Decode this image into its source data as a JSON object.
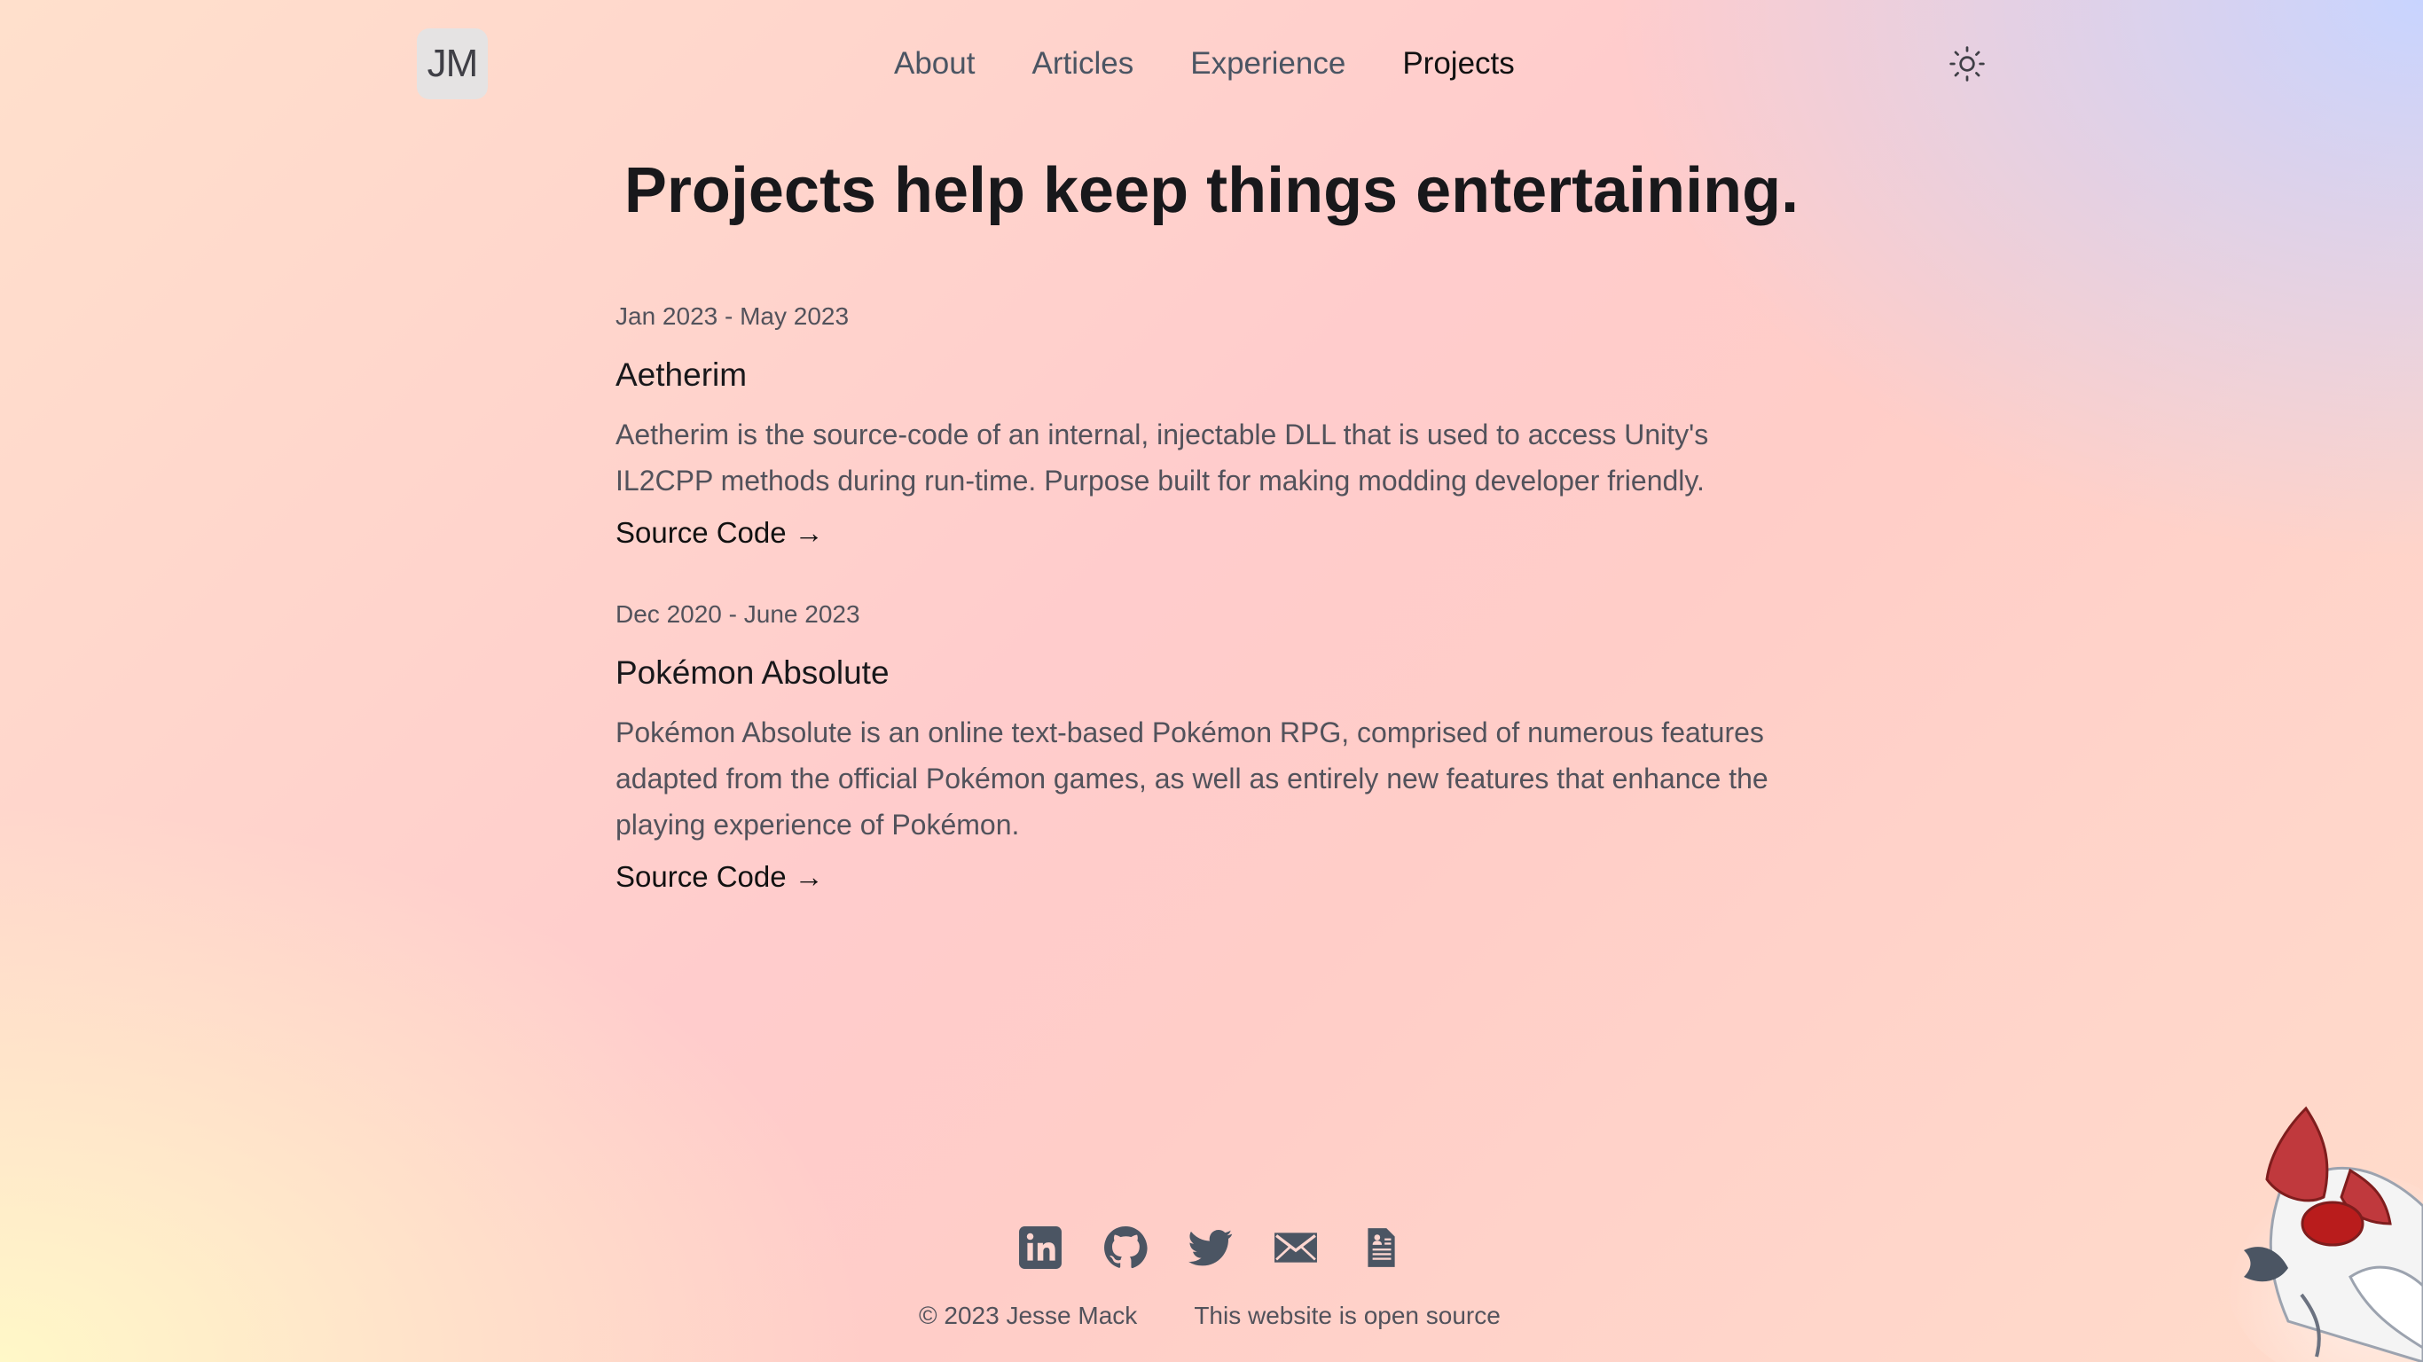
{
  "header": {
    "logo_text": "JM",
    "nav": [
      {
        "label": "About"
      },
      {
        "label": "Articles"
      },
      {
        "label": "Experience"
      },
      {
        "label": "Projects",
        "active": true
      }
    ],
    "theme_toggle_icon": "sun-icon"
  },
  "main": {
    "title": "Projects help keep things entertaining.",
    "projects": [
      {
        "date": "Jan 2023 - May 2023",
        "name": "Aetherim",
        "description": "Aetherim is the source-code of an internal, injectable DLL that is used to access Unity's IL2CPP methods during run-time. Purpose built for making modding developer friendly.",
        "link_label": "Source Code →"
      },
      {
        "date": "Dec 2020 - June 2023",
        "name": "Pokémon Absolute",
        "description": "Pokémon Absolute is an online text-based Pokémon RPG, comprised of numerous features adapted from the official Pokémon games, as well as entirely new features that enhance the playing experience of Pokémon.",
        "link_label": "Source Code →"
      }
    ]
  },
  "footer": {
    "socials": [
      "linkedin-icon",
      "github-icon",
      "twitter-icon",
      "mail-icon",
      "resume-icon"
    ],
    "copyright": "© 2023 Jesse Mack",
    "open_source": "This website is open source"
  },
  "colors": {
    "text_primary": "#18181b",
    "text_secondary": "#52525b",
    "icon": "#4b5563"
  }
}
